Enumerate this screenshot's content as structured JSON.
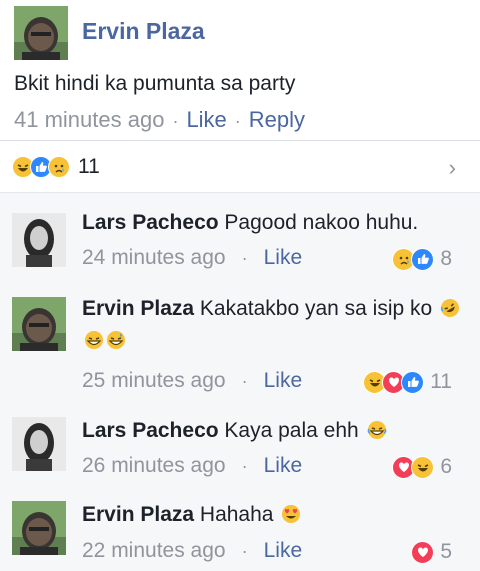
{
  "post": {
    "author": "Ervin Plaza",
    "text": "Bkit hindi ka pumunta sa party",
    "time": "41 minutes ago",
    "like_label": "Like",
    "reply_label": "Reply",
    "separator": "·"
  },
  "reactions": {
    "icons": [
      "laugh-icon",
      "like-icon",
      "sad-icon"
    ],
    "count": "11",
    "chevron": "›"
  },
  "comments": [
    {
      "author": "Lars Pacheco",
      "text": "Pagood nakoo huhu.",
      "time": "24 minutes ago",
      "like_label": "Like",
      "reaction_icons": [
        "sad-icon",
        "like-icon"
      ],
      "reaction_count": "8"
    },
    {
      "author": "Ervin Plaza",
      "text": "Kakatakbo yan sa isip ko",
      "emoji": [
        "rolling-laugh-emoji",
        "grin-sweat-emoji",
        "grin-sweat-emoji"
      ],
      "time": "25 minutes ago",
      "like_label": "Like",
      "reaction_icons": [
        "laugh-icon",
        "love-icon",
        "like-icon"
      ],
      "reaction_count": "11"
    },
    {
      "author": "Lars Pacheco",
      "text": "Kaya pala ehh",
      "emoji": [
        "tears-of-joy-emoji"
      ],
      "time": "26 minutes ago",
      "like_label": "Like",
      "reaction_icons": [
        "love-icon",
        "laugh-icon"
      ],
      "reaction_count": "6"
    },
    {
      "author": "Ervin Plaza",
      "text": "Hahaha",
      "emoji": [
        "heart-eyes-emoji"
      ],
      "time": "22 minutes ago",
      "like_label": "Like",
      "reaction_icons": [
        "love-icon"
      ],
      "reaction_count": "5"
    }
  ],
  "colors": {
    "link": "#4b67a1",
    "meta": "#90949c",
    "like_blue": "#2d88ff",
    "love_red": "#f33e58",
    "emoji_yellow": "#f7c236"
  }
}
